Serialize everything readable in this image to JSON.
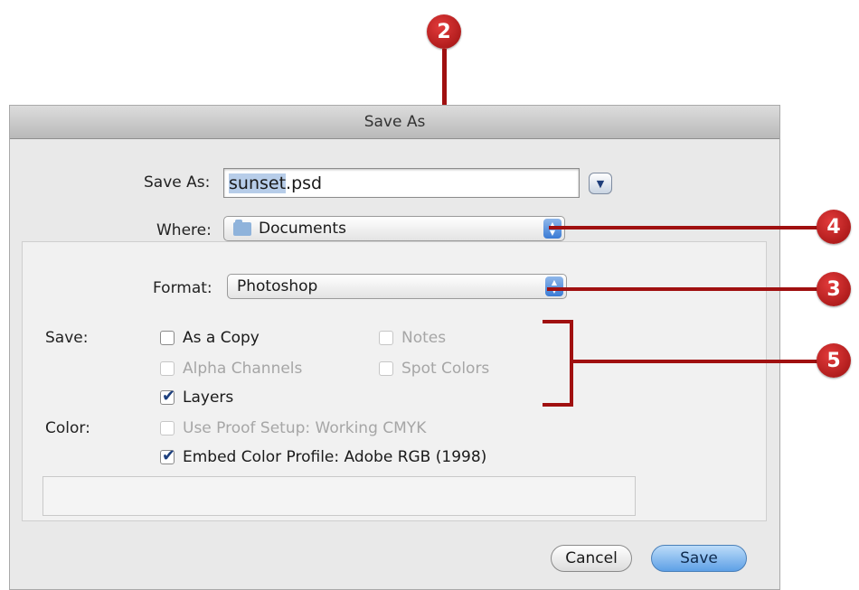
{
  "dialog": {
    "title": "Save As",
    "save_as_label": "Save As:",
    "filename_selected": "sunset",
    "filename_ext": ".psd",
    "where_label": "Where:",
    "where_value": "Documents",
    "format_label": "Format:",
    "format_value": "Photoshop",
    "save_section_label": "Save:",
    "color_section_label": "Color:",
    "options": {
      "as_copy": "As a Copy",
      "notes": "Notes",
      "alpha_channels": "Alpha Channels",
      "spot_colors": "Spot Colors",
      "layers": "Layers",
      "use_proof_setup": "Use Proof Setup:  Working CMYK",
      "embed_color_profile": "Embed Color Profile:  Adobe RGB (1998)"
    },
    "cancel_label": "Cancel",
    "save_label": "Save"
  },
  "callouts": [
    "2",
    "4",
    "3",
    "5"
  ],
  "icons": {
    "expand": "chevron-down-icon",
    "folder": "folder-icon",
    "popup_arrows": "up-down-arrows-icon",
    "checkmark": "checkmark-icon"
  },
  "colors": {
    "callout": "#b81c1c",
    "save_button": "#5ea0e6"
  }
}
